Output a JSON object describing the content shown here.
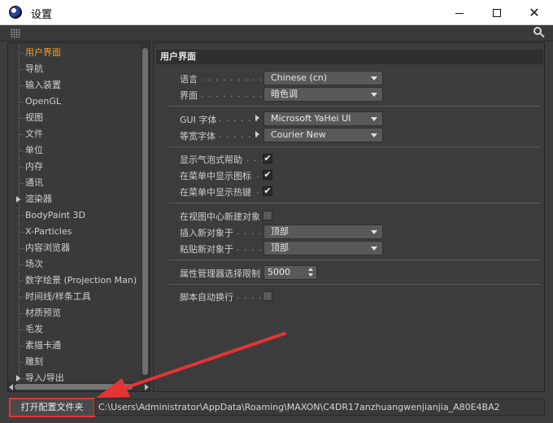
{
  "window": {
    "title": "设置",
    "icon": "cinema4d-logo-icon",
    "controls": [
      "minimize",
      "maximize",
      "close"
    ],
    "close_glyph": "✕"
  },
  "toolbar": {
    "icons": [
      "grip-icon",
      "search-icon"
    ]
  },
  "sidebar": {
    "items": [
      {
        "label": "用户界面",
        "selected": true,
        "expandable": false
      },
      {
        "label": "导航",
        "selected": false,
        "expandable": false
      },
      {
        "label": "输入装置",
        "selected": false,
        "expandable": false
      },
      {
        "label": "OpenGL",
        "selected": false,
        "expandable": false
      },
      {
        "label": "视图",
        "selected": false,
        "expandable": false
      },
      {
        "label": "文件",
        "selected": false,
        "expandable": false
      },
      {
        "label": "单位",
        "selected": false,
        "expandable": false
      },
      {
        "label": "内存",
        "selected": false,
        "expandable": false
      },
      {
        "label": "通讯",
        "selected": false,
        "expandable": false
      },
      {
        "label": "渲染器",
        "selected": false,
        "expandable": true
      },
      {
        "label": "BodyPaint 3D",
        "selected": false,
        "expandable": false
      },
      {
        "label": "X-Particles",
        "selected": false,
        "expandable": false
      },
      {
        "label": "内容浏览器",
        "selected": false,
        "expandable": false
      },
      {
        "label": "场次",
        "selected": false,
        "expandable": false
      },
      {
        "label": "数字绘景 (Projection Man)",
        "selected": false,
        "expandable": false
      },
      {
        "label": "时间线/样条工具",
        "selected": false,
        "expandable": false
      },
      {
        "label": "材质预览",
        "selected": false,
        "expandable": false
      },
      {
        "label": "毛发",
        "selected": false,
        "expandable": false
      },
      {
        "label": "素描卡通",
        "selected": false,
        "expandable": false
      },
      {
        "label": "雕刻",
        "selected": false,
        "expandable": false
      },
      {
        "label": "导入/导出",
        "selected": false,
        "expandable": true
      }
    ]
  },
  "main": {
    "section_title": "用户界面",
    "language": {
      "label": "语言",
      "dots": ". . . . . . . . . . . .",
      "value": "Chinese (cn)"
    },
    "interface": {
      "label": "界面",
      "dots": ". . . . . . . . . . . .",
      "value": "暗色调"
    },
    "gui_font": {
      "label": "GUI 字体",
      "dots": ". . . . . . . .",
      "value": "Microsoft YaHei UI"
    },
    "mono_font": {
      "label": "等宽字体",
      "dots": ". . . . . . . .",
      "value": "Courier New"
    },
    "show_tooltips": {
      "label": "显示气泡式帮助",
      "dots": ". . .",
      "checked": true,
      "mark": "✔"
    },
    "menu_icons": {
      "label": "在菜单中显示图标",
      "dots": ".",
      "checked": true,
      "mark": "✔"
    },
    "menu_hotkeys": {
      "label": "在菜单中显示热键",
      "dots": ".",
      "checked": true,
      "mark": "✔"
    },
    "new_object_center": {
      "label": "在视图中心新建对象",
      "checked": false
    },
    "insert_new_object": {
      "label": "插入新对象于",
      "dots": ". . . . .",
      "value": "顶部"
    },
    "paste_new_object": {
      "label": "粘贴新对象于",
      "dots": ". . . . .",
      "value": "顶部"
    },
    "attr_manager_limit": {
      "label": "属性管理器选择限制",
      "value": "5000"
    },
    "script_autowrap": {
      "label": "脚本自动换行",
      "dots": ". . . . .",
      "checked": false
    }
  },
  "footer": {
    "open_folder_label": "打开配置文件夹",
    "path": "C:\\Users\\Administrator\\AppData\\Roaming\\MAXON\\C4DR17anzhuangwenjianjia_A80E4BA2"
  },
  "colors": {
    "selected_item": "#f0a030",
    "highlight_box": "#e53434",
    "panel_bg": "#3c3c3c"
  }
}
